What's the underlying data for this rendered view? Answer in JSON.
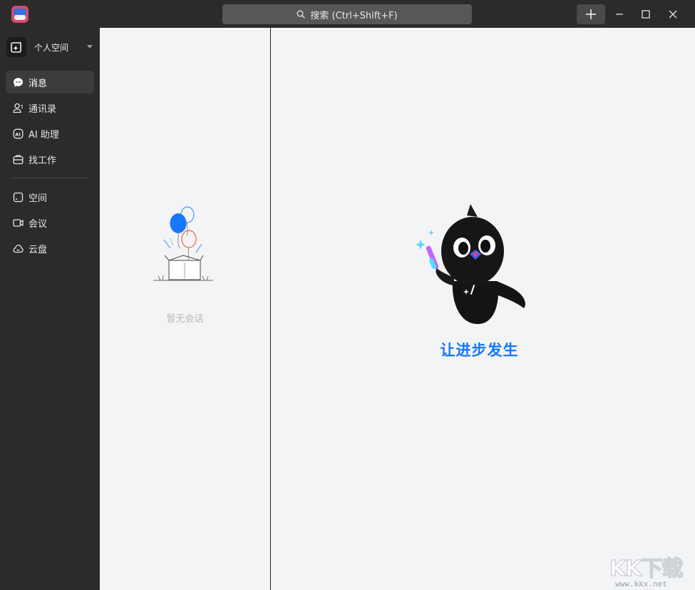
{
  "titlebar": {
    "search_label": "搜索 (Ctrl+Shift+F)"
  },
  "sidebar": {
    "space_label": "个人空间",
    "items": [
      {
        "label": "消息",
        "icon": "message-icon",
        "active": true
      },
      {
        "label": "通讯录",
        "icon": "contacts-icon",
        "active": false
      },
      {
        "label": "AI 助理",
        "icon": "ai-assistant-icon",
        "active": false
      },
      {
        "label": "找工作",
        "icon": "briefcase-icon",
        "active": false
      },
      {
        "label": "空间",
        "icon": "space-icon",
        "active": false
      },
      {
        "label": "会议",
        "icon": "video-icon",
        "active": false
      },
      {
        "label": "云盘",
        "icon": "cloud-icon",
        "active": false
      }
    ]
  },
  "sessions": {
    "empty_text": "暂无会话"
  },
  "main": {
    "slogan": "让进步发生"
  },
  "watermark": {
    "big": "KK下载",
    "small": "www.kkx.net"
  },
  "colors": {
    "accent": "#1677ff",
    "sidebar_bg": "#2b2b2b",
    "content_bg": "#f3f4f6"
  }
}
